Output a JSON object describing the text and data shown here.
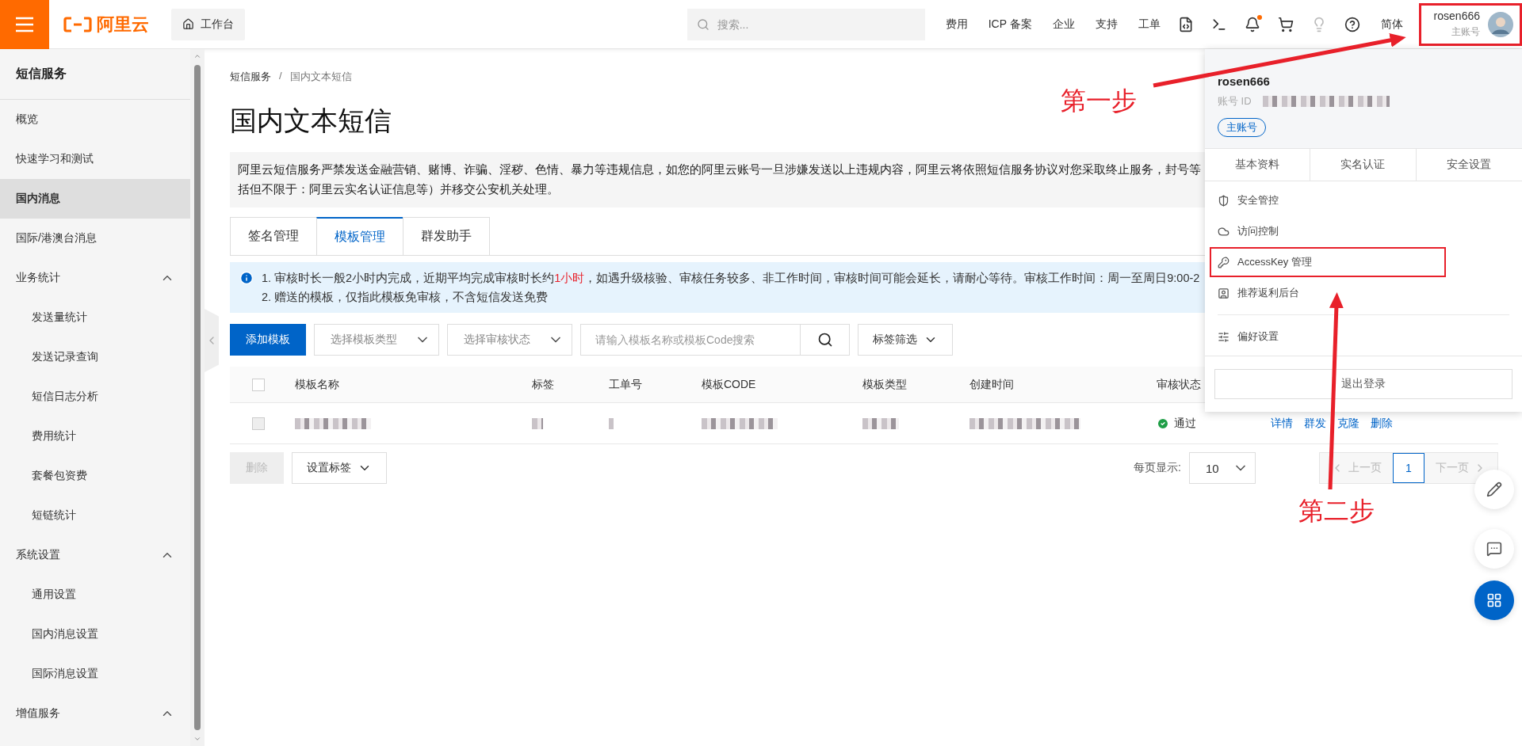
{
  "topbar": {
    "logo_text": "阿里云",
    "workbench": "工作台",
    "search": {
      "placeholder": "搜索..."
    },
    "links": [
      "费用",
      "ICP 备案",
      "企业",
      "支持",
      "工单"
    ],
    "notification_dot": true,
    "language": "简体",
    "user": {
      "name": "rosen666",
      "role": "主账号",
      "highlighted": true
    }
  },
  "sidebar": {
    "title": "短信服务",
    "items": [
      {
        "label": "概览",
        "selected": false
      },
      {
        "label": "快速学习和测试",
        "selected": false
      },
      {
        "label": "国内消息",
        "selected": true
      },
      {
        "label": "国际/港澳台消息",
        "selected": false
      },
      {
        "label": "业务统计",
        "selected": false,
        "expanded": true,
        "children": [
          {
            "label": "发送量统计",
            "selected": false
          },
          {
            "label": "发送记录查询",
            "selected": false
          },
          {
            "label": "短信日志分析",
            "selected": false
          },
          {
            "label": "费用统计",
            "selected": false
          },
          {
            "label": "套餐包资费",
            "selected": false
          },
          {
            "label": "短链统计",
            "selected": false
          }
        ]
      },
      {
        "label": "系统设置",
        "selected": false,
        "expanded": true,
        "children": [
          {
            "label": "通用设置",
            "selected": false
          },
          {
            "label": "国内消息设置",
            "selected": false
          },
          {
            "label": "国际消息设置",
            "selected": false
          }
        ]
      },
      {
        "label": "增值服务",
        "selected": false,
        "expanded": true
      }
    ]
  },
  "breadcrumb": [
    "短信服务",
    "国内文本短信"
  ],
  "breadcrumb_separator": "/",
  "page_title": "国内文本短信",
  "notice": [
    "阿里云短信服务严禁发送金融营销、赌博、诈骗、淫秽、色情、暴力等违规信息，如您的阿里云账号一旦涉嫌发送以上违规内容，阿里云将依照短信服务协议对您采取终止服务，封号等",
    "括但不限于：阿里云实名认证信息等）并移交公安机关处理。"
  ],
  "tabs": [
    {
      "label": "签名管理",
      "selected": false
    },
    {
      "label": "模板管理",
      "selected": true
    },
    {
      "label": "群发助手",
      "selected": false
    }
  ],
  "info": [
    {
      "prefix": "1. 审核时长一般2小时内完成，近期平均完成审核时长约",
      "highlight": "1小时",
      "suffix": "，如遇升级核验、审核任务较多、非工作时间，审核时间可能会延长，请耐心等待。审核工作时间：周一至周日9:00-2"
    },
    {
      "prefix": "2. 赠送的模板，仅指此模板免审核，不含短信发送免费"
    }
  ],
  "toolbar": {
    "add_button": "添加模板",
    "selects": [
      {
        "placeholder": "选择模板类型"
      },
      {
        "placeholder": "选择审核状态"
      }
    ],
    "search": {
      "placeholder": "请输入模板名称或模板Code搜索"
    },
    "tag_filter": "标签筛选"
  },
  "table": {
    "all_checked": false,
    "columns": [
      "模板名称",
      "标签",
      "工单号",
      "模板CODE",
      "模板类型",
      "创建时间",
      "审核状态"
    ],
    "rows": [
      {
        "checked": false,
        "status": "通过",
        "actions": [
          "详情",
          "群发",
          "克隆",
          "删除"
        ]
      }
    ]
  },
  "footer": {
    "delete_button": {
      "label": "删除",
      "disabled": true
    },
    "tag_button": "设置标签",
    "page_size_label": "每页显示:",
    "page_size": "10",
    "prev": {
      "label": "上一页",
      "disabled": true
    },
    "pages": [
      {
        "label": "1",
        "selected": true
      }
    ],
    "next": {
      "label": "下一页",
      "disabled": true
    }
  },
  "account_menu": {
    "name": "rosen666",
    "id_label": "账号 ID",
    "badge": "主账号",
    "tabs": [
      "基本资料",
      "实名认证",
      "安全设置"
    ],
    "items": [
      {
        "kind": "shield",
        "label": "安全管控",
        "highlighted": false
      },
      {
        "kind": "cloud",
        "label": "访问控制",
        "highlighted": false
      },
      {
        "kind": "key",
        "label": "AccessKey 管理",
        "highlighted": true
      },
      {
        "kind": "card",
        "label": "推荐返利后台",
        "highlighted": false
      },
      {
        "kind": "divider"
      },
      {
        "kind": "sliders",
        "label": "偏好设置",
        "highlighted": false
      }
    ],
    "logout": "退出登录"
  },
  "annotations": [
    {
      "kind": "step",
      "text": "第一步"
    },
    {
      "kind": "step",
      "text": "第二步"
    }
  ]
}
